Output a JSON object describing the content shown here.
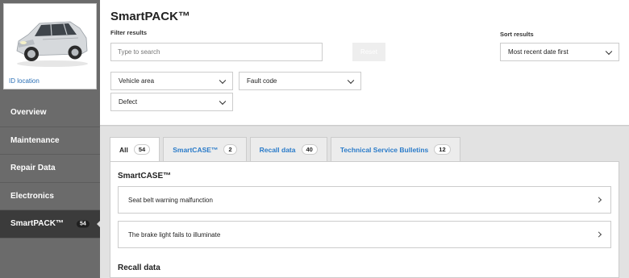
{
  "sidebar": {
    "id_location": "ID location",
    "vehicle_image": "suv-car-image",
    "items": [
      {
        "label": "Overview"
      },
      {
        "label": "Maintenance"
      },
      {
        "label": "Repair Data"
      },
      {
        "label": "Electronics"
      },
      {
        "label": "SmartPACK™",
        "badge": "54",
        "active": true
      }
    ]
  },
  "header": {
    "title": "SmartPACK™",
    "filter_label": "Filter results",
    "sort_label": "Sort results",
    "search_placeholder": "Type to search",
    "reset_label": "Reset",
    "sort_value": "Most recent date first",
    "vehicle_area": "Vehicle area",
    "fault_code": "Fault code",
    "defect": "Defect"
  },
  "tabs": [
    {
      "label": "All",
      "count": "54",
      "active": true
    },
    {
      "label": "SmartCASE™",
      "count": "2"
    },
    {
      "label": "Recall data",
      "count": "40"
    },
    {
      "label": "Technical Service Bulletins",
      "count": "12"
    }
  ],
  "sections": {
    "smartcase_title": "SmartCASE™",
    "smartcase_items": [
      "Seat belt warning malfunction",
      "The brake light fails to illuminate"
    ],
    "recall_title": "Recall data"
  },
  "colors": {
    "link": "#2a7bc9",
    "sidebar": "#6b6b6b",
    "sidebar_active": "#3b3b3b"
  }
}
